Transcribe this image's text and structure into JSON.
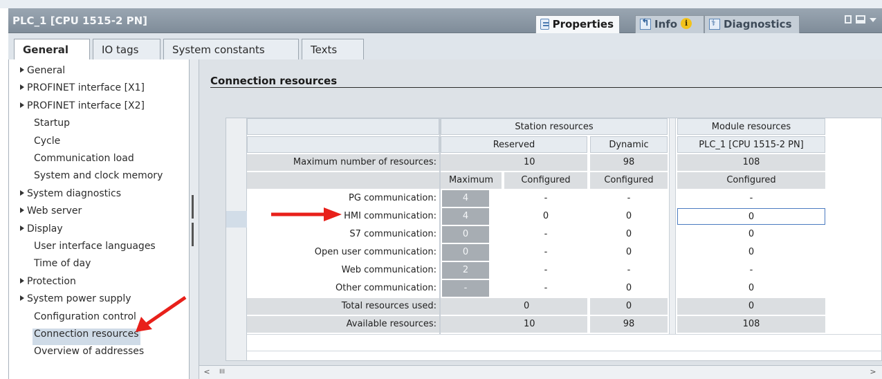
{
  "window": {
    "title": "PLC_1 [CPU 1515-2 PN]",
    "tabs": [
      {
        "label": "Properties",
        "icon": "properties-icon",
        "active": true
      },
      {
        "label": "Info",
        "icon": "info-icon",
        "active": false
      },
      {
        "label": "Diagnostics",
        "icon": "diagnostics-icon",
        "active": false
      }
    ],
    "info_badge": "i"
  },
  "subtabs": [
    "General",
    "IO tags",
    "System constants",
    "Texts"
  ],
  "nav": {
    "items": [
      {
        "label": "General",
        "expandable": true
      },
      {
        "label": "PROFINET interface [X1]",
        "expandable": true
      },
      {
        "label": "PROFINET interface [X2]",
        "expandable": true
      },
      {
        "label": "Startup",
        "expandable": false
      },
      {
        "label": "Cycle",
        "expandable": false
      },
      {
        "label": "Communication load",
        "expandable": false
      },
      {
        "label": "System and clock memory",
        "expandable": false
      },
      {
        "label": "System diagnostics",
        "expandable": true
      },
      {
        "label": "Web server",
        "expandable": true
      },
      {
        "label": "Display",
        "expandable": true
      },
      {
        "label": "User interface languages",
        "expandable": false
      },
      {
        "label": "Time of day",
        "expandable": false
      },
      {
        "label": "Protection",
        "expandable": true
      },
      {
        "label": "System power supply",
        "expandable": true
      },
      {
        "label": "Configuration control",
        "expandable": false
      },
      {
        "label": "Connection resources",
        "expandable": false,
        "selected": true
      },
      {
        "label": "Overview of addresses",
        "expandable": false
      }
    ]
  },
  "section": {
    "title": "Connection resources"
  },
  "table": {
    "group_station": "Station resources",
    "group_module": "Module resources",
    "sub_reserved": "Reserved",
    "sub_dynamic": "Dynamic",
    "sub_module": "PLC_1 [CPU 1515-2 PN]",
    "max_label": "Maximum number of resources:",
    "max_reserved": "10",
    "max_dynamic": "98",
    "max_module": "108",
    "col_maximum": "Maximum",
    "col_configured": "Configured",
    "col_dyn_configured": "Configured",
    "col_mod_configured": "Configured",
    "rows": [
      {
        "label": "PG communication:",
        "max": "4",
        "configured": "-",
        "dynamic": "-",
        "module": "-"
      },
      {
        "label": "HMI communication:",
        "max": "4",
        "configured": "0",
        "dynamic": "0",
        "module": "0"
      },
      {
        "label": "S7 communication:",
        "max": "0",
        "configured": "-",
        "dynamic": "0",
        "module": "0"
      },
      {
        "label": "Open user communication:",
        "max": "0",
        "configured": "-",
        "dynamic": "0",
        "module": "0"
      },
      {
        "label": "Web communication:",
        "max": "2",
        "configured": "-",
        "dynamic": "-",
        "module": "-"
      },
      {
        "label": "Other communication:",
        "max": "-",
        "configured": "-",
        "dynamic": "0",
        "module": "0"
      }
    ],
    "total_label": "Total resources used:",
    "total_reserved": "0",
    "total_dynamic": "0",
    "total_module": "0",
    "avail_label": "Available resources:",
    "avail_reserved": "10",
    "avail_dynamic": "98",
    "avail_module": "108"
  },
  "scroll": {
    "left": "<",
    "thumb": "III",
    "right": ">"
  },
  "colors": {
    "annotation_arrow": "#e8201a",
    "selected_nav": "#cfdbe7",
    "maximum_cell": "#a7adb3"
  }
}
